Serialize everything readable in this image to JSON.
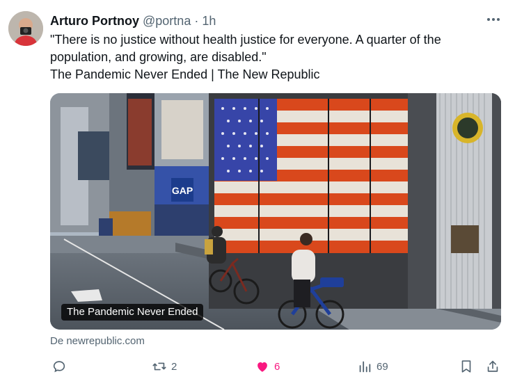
{
  "tweet": {
    "author_name": "Arturo Portnoy",
    "handle": "@portna",
    "separator": "·",
    "time": "1h",
    "text_lines": [
      "\"There is no justice without health justice for everyone. A quarter of the",
      "population, and growing, are disabled.\"",
      "The Pandemic Never Ended | The New Republic"
    ]
  },
  "card": {
    "caption": "The Pandemic Never Ended",
    "source": "De newrepublic.com",
    "sign_text": "GAP"
  },
  "actions": {
    "reply_count": "",
    "retweet_count": "2",
    "like_count": "6",
    "views_count": "69"
  },
  "colors": {
    "like_active": "#f91880",
    "muted": "#536471",
    "text": "#0f1419"
  },
  "icons": [
    "more-icon",
    "reply-icon",
    "retweet-icon",
    "like-icon",
    "views-icon",
    "bookmark-icon",
    "share-icon"
  ]
}
